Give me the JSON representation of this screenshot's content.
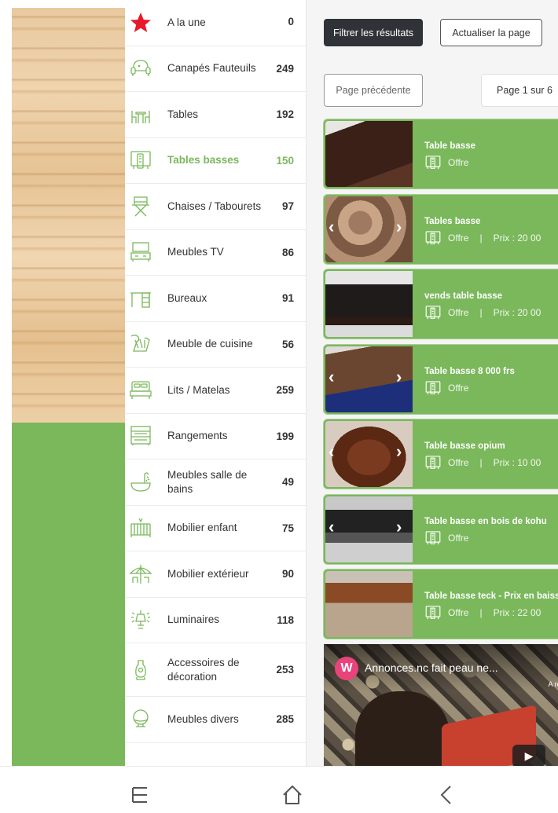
{
  "colors": {
    "accent": "#7ab85b",
    "dark_button": "#2f3338",
    "star": "#e8192c"
  },
  "categories": [
    {
      "label": "A la une",
      "count": "0",
      "icon": "star-icon",
      "active": false
    },
    {
      "label": "Canapés Fauteuils",
      "count": "249",
      "icon": "sofa-icon",
      "active": false
    },
    {
      "label": "Tables",
      "count": "192",
      "icon": "table-icon",
      "active": false
    },
    {
      "label": "Tables basses",
      "count": "150",
      "icon": "coffee-table-icon",
      "active": true
    },
    {
      "label": "Chaises / Tabourets",
      "count": "97",
      "icon": "chair-icon",
      "active": false
    },
    {
      "label": "Meubles TV",
      "count": "86",
      "icon": "tv-stand-icon",
      "active": false
    },
    {
      "label": "Bureaux",
      "count": "91",
      "icon": "desk-icon",
      "active": false
    },
    {
      "label": "Meuble de cuisine",
      "count": "56",
      "icon": "kitchen-icon",
      "active": false
    },
    {
      "label": "Lits / Matelas",
      "count": "259",
      "icon": "bed-icon",
      "active": false
    },
    {
      "label": "Rangements",
      "count": "199",
      "icon": "storage-icon",
      "active": false
    },
    {
      "label": "Meubles salle de bains",
      "count": "49",
      "icon": "bathtub-icon",
      "active": false
    },
    {
      "label": "Mobilier enfant",
      "count": "75",
      "icon": "crib-icon",
      "active": false
    },
    {
      "label": "Mobilier extérieur",
      "count": "90",
      "icon": "parasol-icon",
      "active": false
    },
    {
      "label": "Luminaires",
      "count": "118",
      "icon": "lamp-icon",
      "active": false
    },
    {
      "label": "Accessoires de décoration",
      "count": "253",
      "icon": "vase-icon",
      "active": false
    },
    {
      "label": "Meubles divers",
      "count": "285",
      "icon": "misc-furniture-icon",
      "active": false
    }
  ],
  "toolbar": {
    "filter_label": "Filtrer les résultats",
    "refresh_label": "Actualiser la page"
  },
  "pagination": {
    "prev_label": "Page précédente",
    "page_label": "Page 1 sur 6"
  },
  "listings": [
    {
      "title": "Table basse",
      "type": "Offre",
      "price": "",
      "carousel": false,
      "thumb": "dark-wood"
    },
    {
      "title": "Tables basse",
      "type": "Offre",
      "price": "Prix : 20 00",
      "carousel": true,
      "thumb": "slab"
    },
    {
      "title": "vends table basse",
      "type": "Offre",
      "price": "Prix : 20 00",
      "carousel": false,
      "thumb": "black-table"
    },
    {
      "title": "Table basse 8 000 frs",
      "type": "Offre",
      "price": "",
      "carousel": true,
      "thumb": "rug"
    },
    {
      "title": "Table basse opium",
      "type": "Offre",
      "price": "Prix : 10 00",
      "carousel": true,
      "thumb": "opium"
    },
    {
      "title": "Table basse en bois de kohu",
      "type": "Offre",
      "price": "",
      "carousel": true,
      "thumb": "kohu"
    },
    {
      "title": "Table basse teck - Prix en baiss",
      "type": "Offre",
      "price": "Prix : 22 00",
      "carousel": false,
      "thumb": "teck"
    }
  ],
  "video": {
    "logo_letter": "W",
    "title": "Annonces.nc fait peau ne...",
    "corner_text": "A rec"
  }
}
